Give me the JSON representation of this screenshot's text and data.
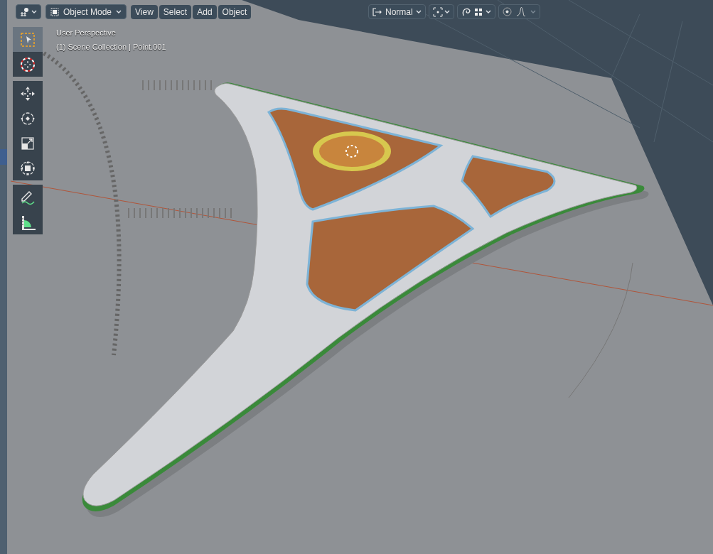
{
  "header": {
    "mode": "Object Mode",
    "menus": [
      "View",
      "Select",
      "Add",
      "Object"
    ],
    "orientation": "Normal"
  },
  "overlay": {
    "view_name": "User Perspective",
    "collection": "(1) Scene Collection | Point.001"
  },
  "toolbar": [
    [
      {
        "kind": "select",
        "selected": true
      },
      {
        "kind": "cursor",
        "selected": false
      }
    ],
    [
      {
        "kind": "move",
        "selected": false
      },
      {
        "kind": "rotate",
        "selected": false
      },
      {
        "kind": "scale",
        "selected": false
      },
      {
        "kind": "transform",
        "selected": false
      }
    ],
    [
      {
        "kind": "annotate",
        "selected": false
      },
      {
        "kind": "measure",
        "selected": false
      }
    ]
  ]
}
